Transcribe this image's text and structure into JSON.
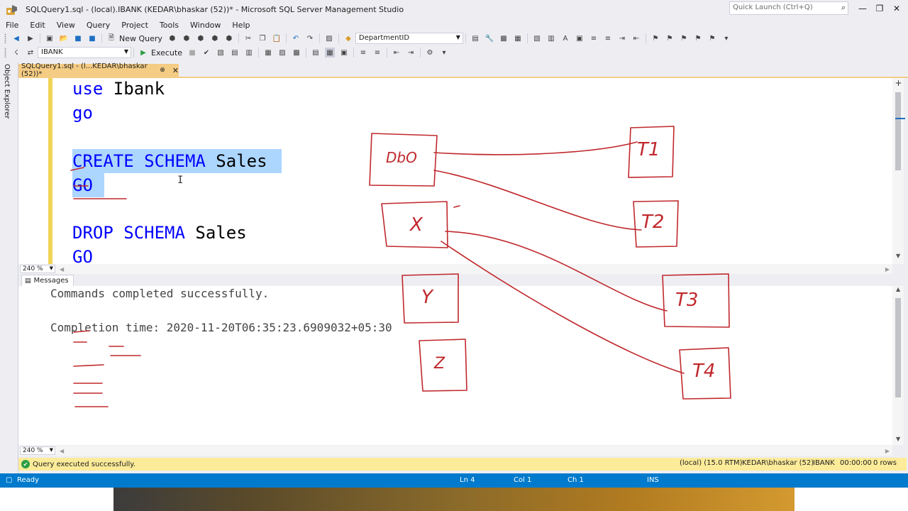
{
  "window": {
    "title": "SQLQuery1.sql - (local).IBANK (KEDAR\\bhaskar (52))* - Microsoft SQL Server Management Studio",
    "quick_launch_placeholder": "Quick Launch (Ctrl+Q)"
  },
  "menu": [
    "File",
    "Edit",
    "View",
    "Query",
    "Project",
    "Tools",
    "Window",
    "Help"
  ],
  "toolbar": {
    "new_query": "New Query",
    "department_combo": "DepartmentID",
    "database_combo": "IBANK",
    "execute": "Execute"
  },
  "side_panel": {
    "label": "Object Explorer"
  },
  "doc_tab": {
    "label": "SQLQuery1.sql - (l...KEDAR\\bhaskar (52))*"
  },
  "editor": {
    "zoom": "240 %",
    "lines": {
      "l1_kw": "use",
      "l1_id": " Ibank",
      "l2_kw": "go",
      "l3_kw1": "CREATE",
      "l3_kw2": " SCHEMA",
      "l3_id": " Sales",
      "l4_kw": "GO",
      "l5_kw1": "DROP",
      "l5_kw2": " SCHEMA",
      "l5_id": " Sales",
      "l6_kw": "GO"
    }
  },
  "messages": {
    "tab": "Messages",
    "line1": "Commands completed successfully.",
    "line2": "Completion time: 2020-11-20T06:35:23.6909032+05:30",
    "zoom": "240 %"
  },
  "query_status": {
    "text": "Query executed successfully.",
    "server": "(local) (15.0 RTM)",
    "user": "KEDAR\\bhaskar (52)",
    "database": "IBANK",
    "elapsed": "00:00:00",
    "rows": "0 rows"
  },
  "status_bar": {
    "state": "Ready",
    "ln": "Ln 4",
    "col": "Col 1",
    "ch": "Ch 1",
    "mode": "INS"
  },
  "sketch": {
    "box_dbo": "DbO",
    "box_x": "X",
    "box_y": "Y",
    "box_z": "Z",
    "box_t1": "T1",
    "box_t2": "T2",
    "box_t3": "T3",
    "box_t4": "T4"
  },
  "colors": {
    "accent": "#007ACC",
    "tab_active": "#F5CC84",
    "keyword": "#0000FF",
    "selection": "#ADD6FF",
    "ink": "#C0282C"
  }
}
